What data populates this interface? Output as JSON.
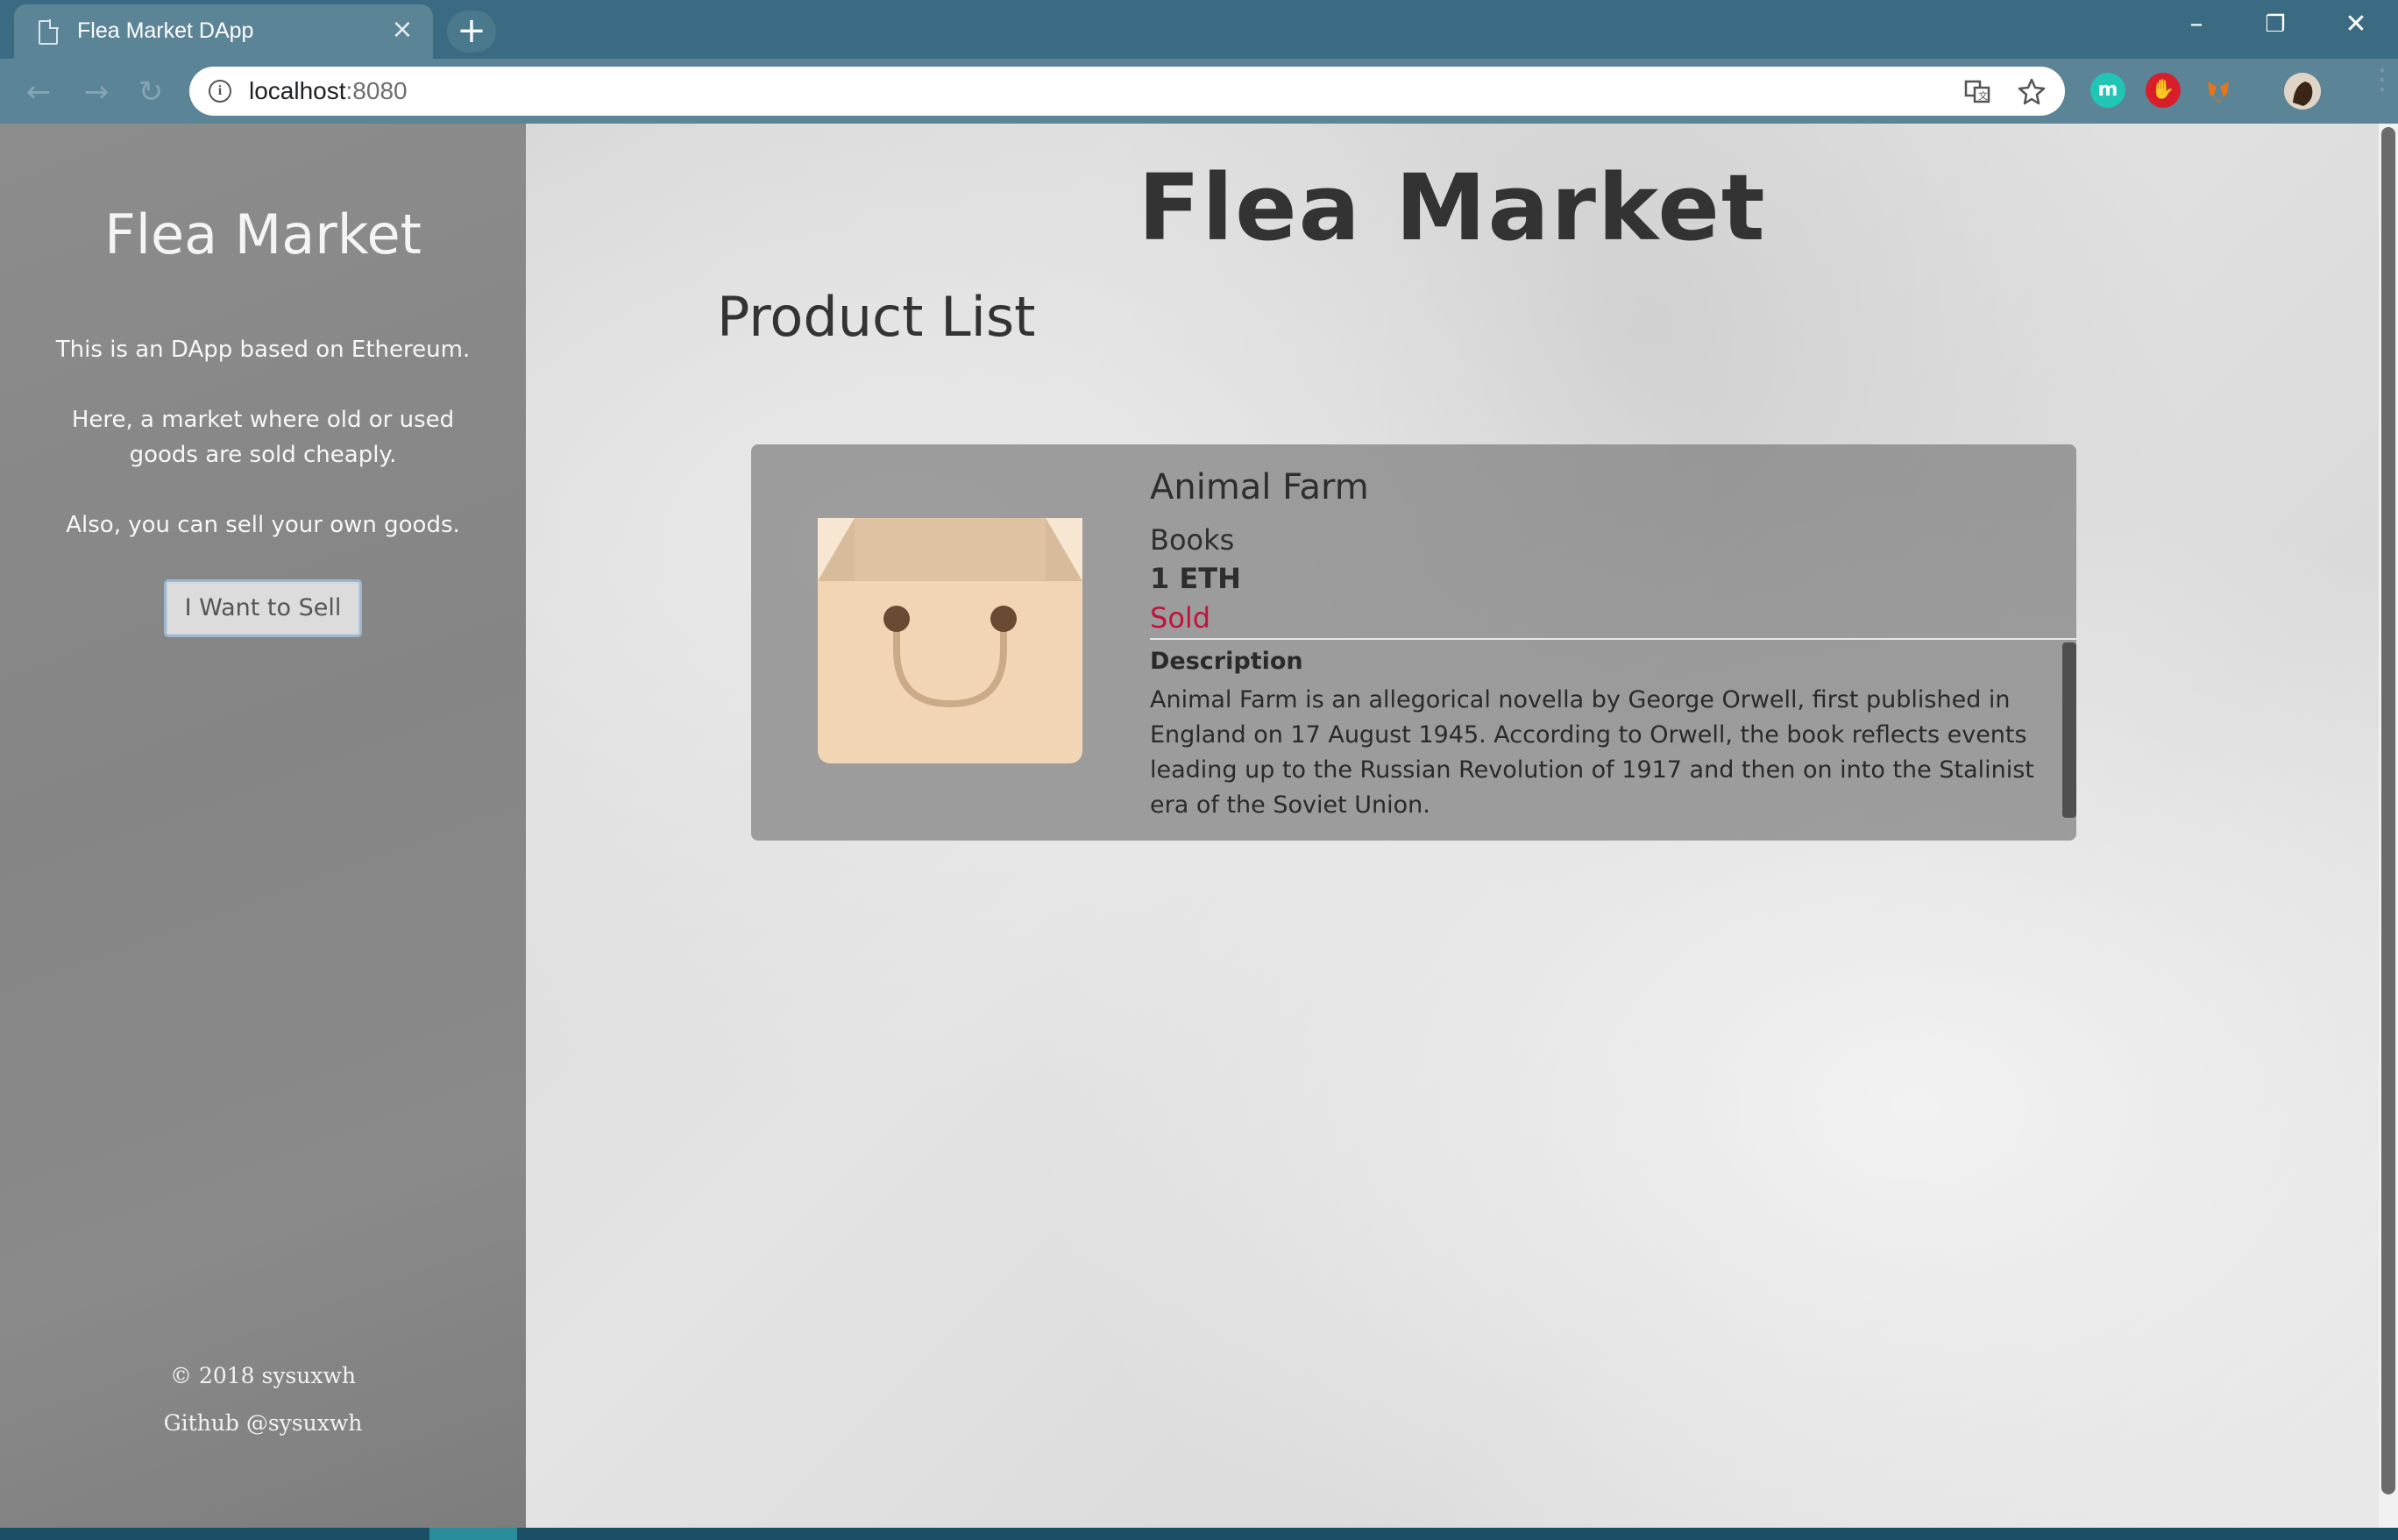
{
  "browser": {
    "tab_title": "Flea Market DApp",
    "tab_close": "×",
    "new_tab": "+",
    "url_host": "localhost",
    "url_port": ":8080",
    "window_controls": {
      "minimize": "–",
      "restore": "❐",
      "close": "✕"
    }
  },
  "sidebar": {
    "title": "Flea Market",
    "line1": "This is an DApp based on Ethereum.",
    "line2": "Here, a market where old or used goods are sold cheaply.",
    "line3": "Also, you can sell your own goods.",
    "sell_button": "I Want to Sell",
    "copyright": "© 2018 sysuxwh",
    "github": "Github @sysuxwh"
  },
  "main": {
    "title": "Flea Market",
    "section_title": "Product List",
    "products": [
      {
        "name": "Animal Farm",
        "category": "Books",
        "price": "1 ETH",
        "status": "Sold",
        "description_label": "Description",
        "description": "Animal Farm is an allegorical novella by George Orwell, first published in England on 17 August 1945. According to Orwell, the book reflects events leading up to the Russian Revolution of 1917 and then on into the Stalinist era of the Soviet Union."
      }
    ]
  },
  "colors": {
    "chrome": "#3b6b82",
    "toolbar": "#5b8497",
    "sidebar": "#878787",
    "sold": "#c0143c",
    "bag": "#f2d5b5"
  },
  "icons": [
    "page-icon",
    "info-icon",
    "translate-icon",
    "star-icon",
    "mendeley-icon",
    "adblock-icon",
    "metamask-icon",
    "profile-avatar",
    "menu-icon",
    "shopping-bag-icon"
  ]
}
